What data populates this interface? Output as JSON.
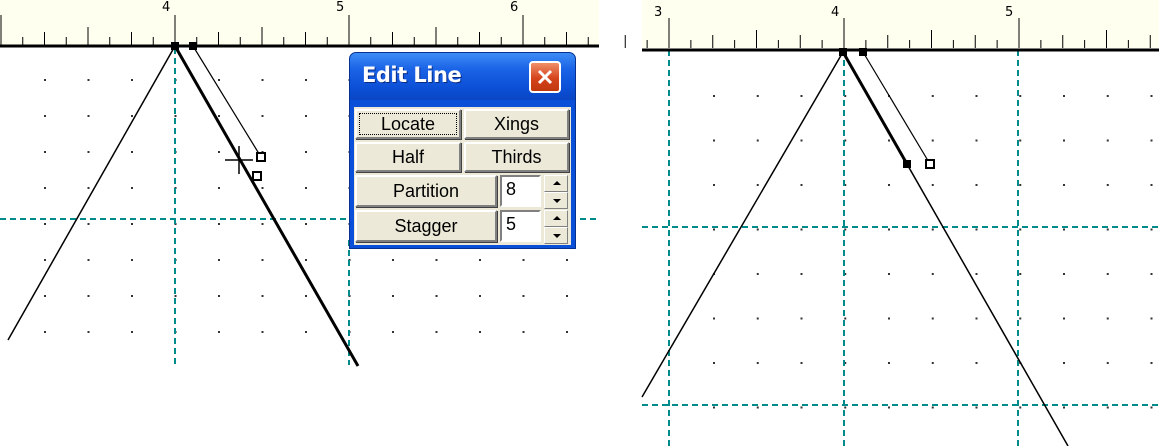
{
  "left_panel": {
    "ruler_labels": [
      "4",
      "5",
      "6"
    ]
  },
  "right_panel": {
    "ruler_labels": [
      "3",
      "4",
      "5"
    ]
  },
  "edit_line_palette": {
    "title": "Edit Line",
    "close_icon": "close-x-icon",
    "buttons": {
      "locate": "Locate",
      "xings": "Xings",
      "half": "Half",
      "thirds": "Thirds",
      "partition": "Partition",
      "stagger": "Stagger"
    },
    "partition_value": "8",
    "stagger_value": "5"
  },
  "colors": {
    "guide_line": "#008b8b",
    "title_bar": "#0a4fd8",
    "close_button": "#d5441c",
    "dialog_face": "#ece9d8"
  }
}
